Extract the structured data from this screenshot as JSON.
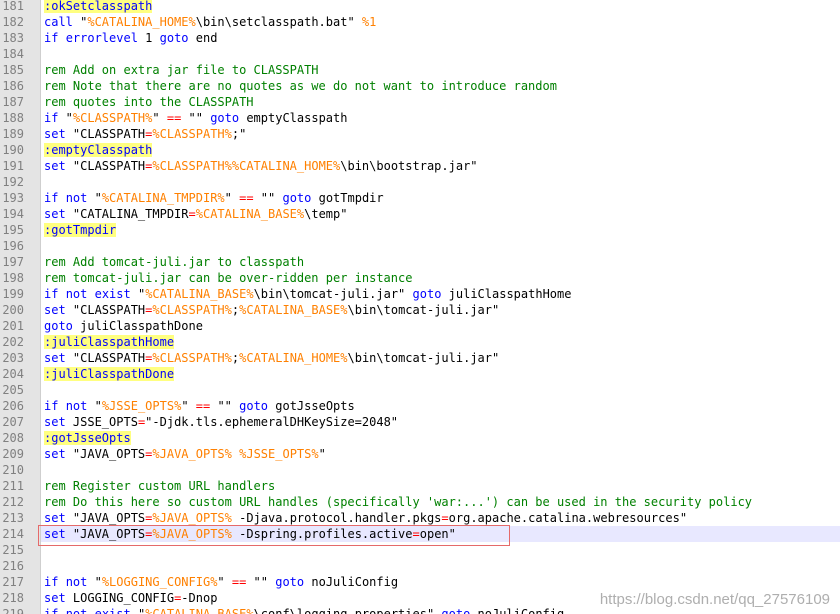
{
  "editor": {
    "lines": [
      {
        "num": "181",
        "tokens": [
          {
            "t": "lbl",
            "v": ":okSetclasspath"
          }
        ]
      },
      {
        "num": "182",
        "tokens": [
          {
            "t": "kw",
            "v": "call"
          },
          {
            "t": "txt",
            "v": " \""
          },
          {
            "t": "var",
            "v": "%CATALINA_HOME%"
          },
          {
            "t": "txt",
            "v": "\\bin\\setclasspath.bat\" "
          },
          {
            "t": "var",
            "v": "%1"
          }
        ]
      },
      {
        "num": "183",
        "tokens": [
          {
            "t": "kw",
            "v": "if"
          },
          {
            "t": "txt",
            "v": " "
          },
          {
            "t": "kw",
            "v": "errorlevel"
          },
          {
            "t": "txt",
            "v": " 1 "
          },
          {
            "t": "kw",
            "v": "goto"
          },
          {
            "t": "txt",
            "v": " end"
          }
        ]
      },
      {
        "num": "184",
        "tokens": []
      },
      {
        "num": "185",
        "tokens": [
          {
            "t": "cmt",
            "v": "rem Add on extra jar file to CLASSPATH"
          }
        ]
      },
      {
        "num": "186",
        "tokens": [
          {
            "t": "cmt",
            "v": "rem Note that there are no quotes as we do not want to introduce random"
          }
        ]
      },
      {
        "num": "187",
        "tokens": [
          {
            "t": "cmt",
            "v": "rem quotes into the CLASSPATH"
          }
        ]
      },
      {
        "num": "188",
        "tokens": [
          {
            "t": "kw",
            "v": "if"
          },
          {
            "t": "txt",
            "v": " \""
          },
          {
            "t": "var",
            "v": "%CLASSPATH%"
          },
          {
            "t": "txt",
            "v": "\" "
          },
          {
            "t": "op",
            "v": "=="
          },
          {
            "t": "txt",
            "v": " \"\" "
          },
          {
            "t": "kw",
            "v": "goto"
          },
          {
            "t": "txt",
            "v": " emptyClasspath"
          }
        ]
      },
      {
        "num": "189",
        "tokens": [
          {
            "t": "kw",
            "v": "set"
          },
          {
            "t": "txt",
            "v": " \"CLASSPATH"
          },
          {
            "t": "op",
            "v": "="
          },
          {
            "t": "var",
            "v": "%CLASSPATH%"
          },
          {
            "t": "txt",
            "v": ";\""
          }
        ]
      },
      {
        "num": "190",
        "tokens": [
          {
            "t": "lbl",
            "v": ":emptyClasspath"
          }
        ]
      },
      {
        "num": "191",
        "tokens": [
          {
            "t": "kw",
            "v": "set"
          },
          {
            "t": "txt",
            "v": " \"CLASSPATH"
          },
          {
            "t": "op",
            "v": "="
          },
          {
            "t": "var",
            "v": "%CLASSPATH%%CATALINA_HOME%"
          },
          {
            "t": "txt",
            "v": "\\bin\\bootstrap.jar\""
          }
        ]
      },
      {
        "num": "192",
        "tokens": []
      },
      {
        "num": "193",
        "tokens": [
          {
            "t": "kw",
            "v": "if"
          },
          {
            "t": "txt",
            "v": " "
          },
          {
            "t": "kw",
            "v": "not"
          },
          {
            "t": "txt",
            "v": " \""
          },
          {
            "t": "var",
            "v": "%CATALINA_TMPDIR%"
          },
          {
            "t": "txt",
            "v": "\" "
          },
          {
            "t": "op",
            "v": "=="
          },
          {
            "t": "txt",
            "v": " \"\" "
          },
          {
            "t": "kw",
            "v": "goto"
          },
          {
            "t": "txt",
            "v": " gotTmpdir"
          }
        ]
      },
      {
        "num": "194",
        "tokens": [
          {
            "t": "kw",
            "v": "set"
          },
          {
            "t": "txt",
            "v": " \"CATALINA_TMPDIR"
          },
          {
            "t": "op",
            "v": "="
          },
          {
            "t": "var",
            "v": "%CATALINA_BASE%"
          },
          {
            "t": "txt",
            "v": "\\temp\""
          }
        ]
      },
      {
        "num": "195",
        "tokens": [
          {
            "t": "lbl",
            "v": ":gotTmpdir"
          }
        ]
      },
      {
        "num": "196",
        "tokens": []
      },
      {
        "num": "197",
        "tokens": [
          {
            "t": "cmt",
            "v": "rem Add tomcat-juli.jar to classpath"
          }
        ]
      },
      {
        "num": "198",
        "tokens": [
          {
            "t": "cmt",
            "v": "rem tomcat-juli.jar can be over-ridden per instance"
          }
        ]
      },
      {
        "num": "199",
        "tokens": [
          {
            "t": "kw",
            "v": "if"
          },
          {
            "t": "txt",
            "v": " "
          },
          {
            "t": "kw",
            "v": "not"
          },
          {
            "t": "txt",
            "v": " "
          },
          {
            "t": "kw",
            "v": "exist"
          },
          {
            "t": "txt",
            "v": " \""
          },
          {
            "t": "var",
            "v": "%CATALINA_BASE%"
          },
          {
            "t": "txt",
            "v": "\\bin\\tomcat-juli.jar\" "
          },
          {
            "t": "kw",
            "v": "goto"
          },
          {
            "t": "txt",
            "v": " juliClasspathHome"
          }
        ]
      },
      {
        "num": "200",
        "tokens": [
          {
            "t": "kw",
            "v": "set"
          },
          {
            "t": "txt",
            "v": " \"CLASSPATH"
          },
          {
            "t": "op",
            "v": "="
          },
          {
            "t": "var",
            "v": "%CLASSPATH%"
          },
          {
            "t": "txt",
            "v": ";"
          },
          {
            "t": "var",
            "v": "%CATALINA_BASE%"
          },
          {
            "t": "txt",
            "v": "\\bin\\tomcat-juli.jar\""
          }
        ]
      },
      {
        "num": "201",
        "tokens": [
          {
            "t": "kw",
            "v": "goto"
          },
          {
            "t": "txt",
            "v": " juliClasspathDone"
          }
        ]
      },
      {
        "num": "202",
        "tokens": [
          {
            "t": "lbl",
            "v": ":juliClasspathHome"
          }
        ]
      },
      {
        "num": "203",
        "tokens": [
          {
            "t": "kw",
            "v": "set"
          },
          {
            "t": "txt",
            "v": " \"CLASSPATH"
          },
          {
            "t": "op",
            "v": "="
          },
          {
            "t": "var",
            "v": "%CLASSPATH%"
          },
          {
            "t": "txt",
            "v": ";"
          },
          {
            "t": "var",
            "v": "%CATALINA_HOME%"
          },
          {
            "t": "txt",
            "v": "\\bin\\tomcat-juli.jar\""
          }
        ]
      },
      {
        "num": "204",
        "tokens": [
          {
            "t": "lbl",
            "v": ":juliClasspathDone"
          }
        ]
      },
      {
        "num": "205",
        "tokens": []
      },
      {
        "num": "206",
        "tokens": [
          {
            "t": "kw",
            "v": "if"
          },
          {
            "t": "txt",
            "v": " "
          },
          {
            "t": "kw",
            "v": "not"
          },
          {
            "t": "txt",
            "v": " \""
          },
          {
            "t": "var",
            "v": "%JSSE_OPTS%"
          },
          {
            "t": "txt",
            "v": "\" "
          },
          {
            "t": "op",
            "v": "=="
          },
          {
            "t": "txt",
            "v": " \"\" "
          },
          {
            "t": "kw",
            "v": "goto"
          },
          {
            "t": "txt",
            "v": " gotJsseOpts"
          }
        ]
      },
      {
        "num": "207",
        "tokens": [
          {
            "t": "kw",
            "v": "set"
          },
          {
            "t": "txt",
            "v": " JSSE_OPTS"
          },
          {
            "t": "op",
            "v": "="
          },
          {
            "t": "txt",
            "v": "\"-Djdk.tls.ephemeralDHKeySize=2048\""
          }
        ]
      },
      {
        "num": "208",
        "tokens": [
          {
            "t": "lbl",
            "v": ":gotJsseOpts"
          }
        ]
      },
      {
        "num": "209",
        "tokens": [
          {
            "t": "kw",
            "v": "set"
          },
          {
            "t": "txt",
            "v": " \"JAVA_OPTS"
          },
          {
            "t": "op",
            "v": "="
          },
          {
            "t": "var",
            "v": "%JAVA_OPTS%"
          },
          {
            "t": "txt",
            "v": " "
          },
          {
            "t": "var",
            "v": "%JSSE_OPTS%"
          },
          {
            "t": "txt",
            "v": "\""
          }
        ]
      },
      {
        "num": "210",
        "tokens": []
      },
      {
        "num": "211",
        "tokens": [
          {
            "t": "cmt",
            "v": "rem Register custom URL handlers"
          }
        ]
      },
      {
        "num": "212",
        "tokens": [
          {
            "t": "cmt",
            "v": "rem Do this here so custom URL handles (specifically 'war:...') can be used in the security policy"
          }
        ]
      },
      {
        "num": "213",
        "tokens": [
          {
            "t": "kw",
            "v": "set"
          },
          {
            "t": "txt",
            "v": " \"JAVA_OPTS"
          },
          {
            "t": "op",
            "v": "="
          },
          {
            "t": "var",
            "v": "%JAVA_OPTS%"
          },
          {
            "t": "txt",
            "v": " -Djava.protocol.handler.pkgs"
          },
          {
            "t": "op",
            "v": "="
          },
          {
            "t": "txt",
            "v": "org.apache.catalina.webresources\""
          }
        ]
      },
      {
        "num": "214",
        "current": true,
        "tokens": [
          {
            "t": "kw",
            "v": "set"
          },
          {
            "t": "txt",
            "v": " \"JAVA_OPTS"
          },
          {
            "t": "op",
            "v": "="
          },
          {
            "t": "var",
            "v": "%JAVA_OPTS%"
          },
          {
            "t": "txt",
            "v": " -Dspring.profiles.active"
          },
          {
            "t": "op",
            "v": "="
          },
          {
            "t": "txt",
            "v": "open\""
          }
        ]
      },
      {
        "num": "215",
        "tokens": []
      },
      {
        "num": "216",
        "tokens": []
      },
      {
        "num": "217",
        "tokens": [
          {
            "t": "kw",
            "v": "if"
          },
          {
            "t": "txt",
            "v": " "
          },
          {
            "t": "kw",
            "v": "not"
          },
          {
            "t": "txt",
            "v": " \""
          },
          {
            "t": "var",
            "v": "%LOGGING_CONFIG%"
          },
          {
            "t": "txt",
            "v": "\" "
          },
          {
            "t": "op",
            "v": "=="
          },
          {
            "t": "txt",
            "v": " \"\" "
          },
          {
            "t": "kw",
            "v": "goto"
          },
          {
            "t": "txt",
            "v": " noJuliConfig"
          }
        ]
      },
      {
        "num": "218",
        "tokens": [
          {
            "t": "kw",
            "v": "set"
          },
          {
            "t": "txt",
            "v": " LOGGING_CONFIG"
          },
          {
            "t": "op",
            "v": "="
          },
          {
            "t": "txt",
            "v": "-Dnop"
          }
        ]
      },
      {
        "num": "219",
        "tokens": [
          {
            "t": "kw",
            "v": "if"
          },
          {
            "t": "txt",
            "v": " "
          },
          {
            "t": "kw",
            "v": "not"
          },
          {
            "t": "txt",
            "v": " "
          },
          {
            "t": "kw",
            "v": "exist"
          },
          {
            "t": "txt",
            "v": " \""
          },
          {
            "t": "var",
            "v": "%CATALINA_BASE%"
          },
          {
            "t": "txt",
            "v": "\\conf\\logging.properties\" "
          },
          {
            "t": "kw",
            "v": "goto"
          },
          {
            "t": "txt",
            "v": " noJuliConfig"
          }
        ]
      }
    ]
  },
  "watermark": "https://blog.csdn.net/qq_27576109",
  "colors": {
    "keyword": "#0000ff",
    "comment": "#008000",
    "variable": "#ff8000",
    "operator": "#ff0000",
    "label_highlight": "#ffff80",
    "current_line": "#e8e8ff",
    "annotation_box": "#e56a6a"
  }
}
